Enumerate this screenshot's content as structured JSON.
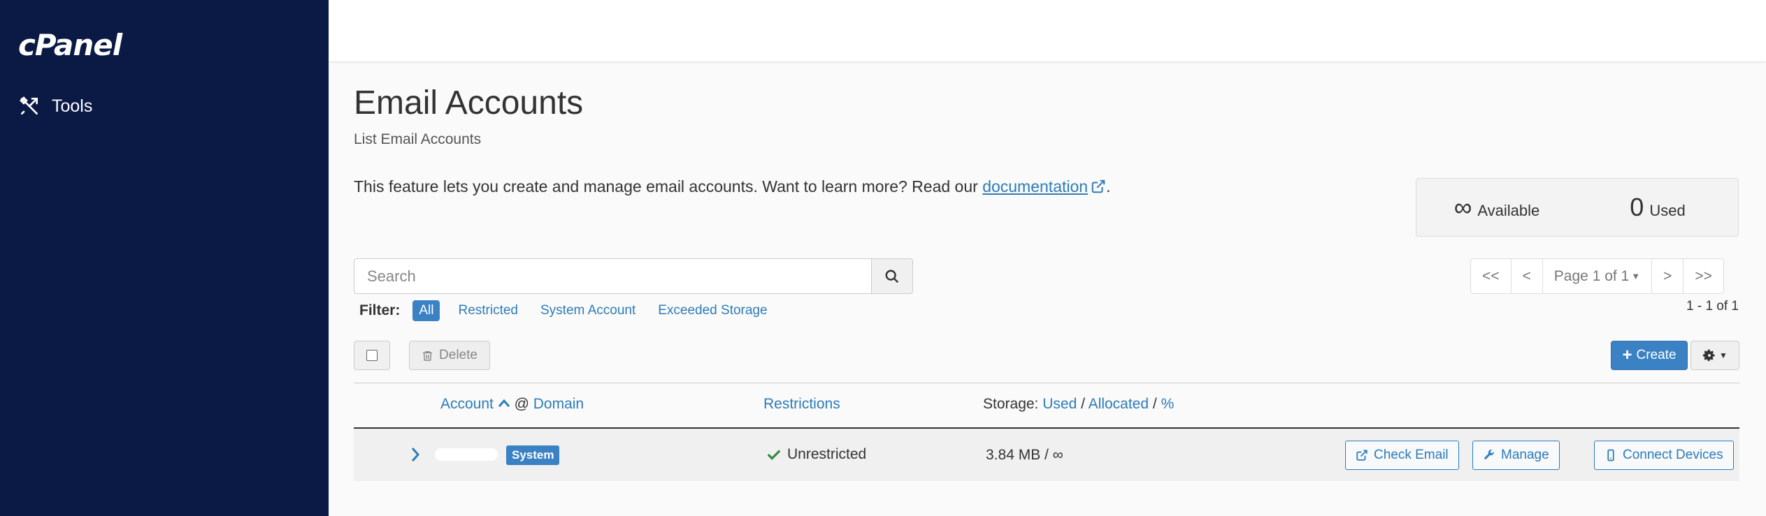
{
  "sidebar": {
    "logo": "cPanel",
    "items": [
      {
        "label": "Tools",
        "icon": "tools-icon"
      }
    ]
  },
  "page": {
    "title": "Email Accounts",
    "subtitle": "List Email Accounts",
    "intro_text": "This feature lets you create and manage email accounts. Want to learn more? Read our ",
    "intro_link": "documentation",
    "intro_end": "."
  },
  "stats": {
    "available_value": "∞",
    "available_label": "Available",
    "used_value": "0",
    "used_label": "Used"
  },
  "search": {
    "placeholder": "Search",
    "value": ""
  },
  "filter": {
    "label": "Filter:",
    "options": [
      "All",
      "Restricted",
      "System Account",
      "Exceeded Storage"
    ],
    "active": "All"
  },
  "pagination": {
    "first": "<<",
    "prev": "<",
    "page_label": "Page 1 of 1",
    "next": ">",
    "last": ">>",
    "count": "1 - 1 of 1"
  },
  "toolbar": {
    "delete_label": "Delete",
    "create_label": "Create"
  },
  "table": {
    "headers": {
      "account": "Account",
      "at": "@",
      "domain": "Domain",
      "restrictions": "Restrictions",
      "storage_prefix": "Storage:",
      "used": "Used",
      "sep1": "/",
      "allocated": "Allocated",
      "sep2": "/",
      "percent": "%"
    },
    "rows": [
      {
        "badge": "System",
        "restriction": "Unrestricted",
        "storage": "3.84 MB / ∞",
        "actions": [
          "Check Email",
          "Manage",
          "Connect Devices"
        ]
      }
    ]
  },
  "colors": {
    "sidebar": "#0b1a45",
    "accent": "#3a82c4",
    "link": "#2d7cb8",
    "success": "#2e8b3d"
  }
}
